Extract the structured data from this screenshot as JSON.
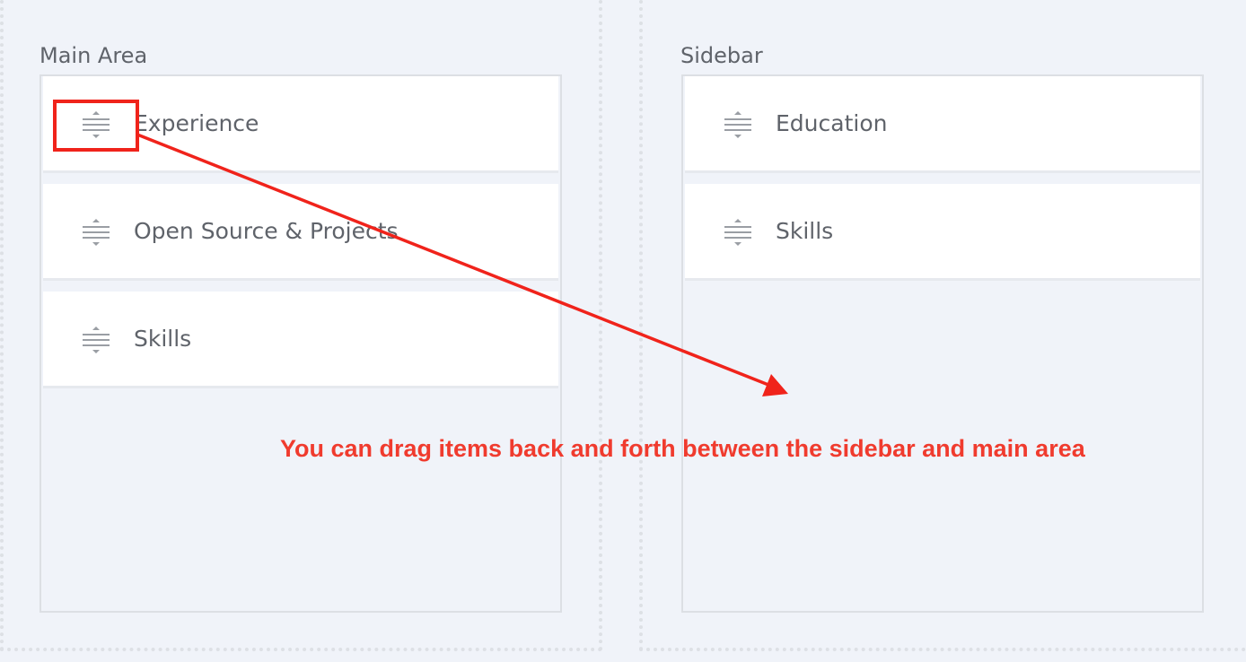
{
  "main_area": {
    "title": "Main Area",
    "items": [
      {
        "label": "Experience",
        "icon": "drag-handle-icon"
      },
      {
        "label": "Open Source & Projects",
        "icon": "drag-handle-icon"
      },
      {
        "label": "Skills",
        "icon": "drag-handle-icon"
      }
    ]
  },
  "sidebar": {
    "title": "Sidebar",
    "items": [
      {
        "label": "Education",
        "icon": "drag-handle-icon"
      },
      {
        "label": "Skills",
        "icon": "drag-handle-icon"
      }
    ]
  },
  "annotation": {
    "text": "You can drag items back and forth between the sidebar and main area",
    "color": "#f03b2e",
    "highlight_color": "#f0231b"
  },
  "colors": {
    "background": "#f0f3f9",
    "card": "#ffffff",
    "text": "#5f636a",
    "icon": "#9a9ea4"
  }
}
